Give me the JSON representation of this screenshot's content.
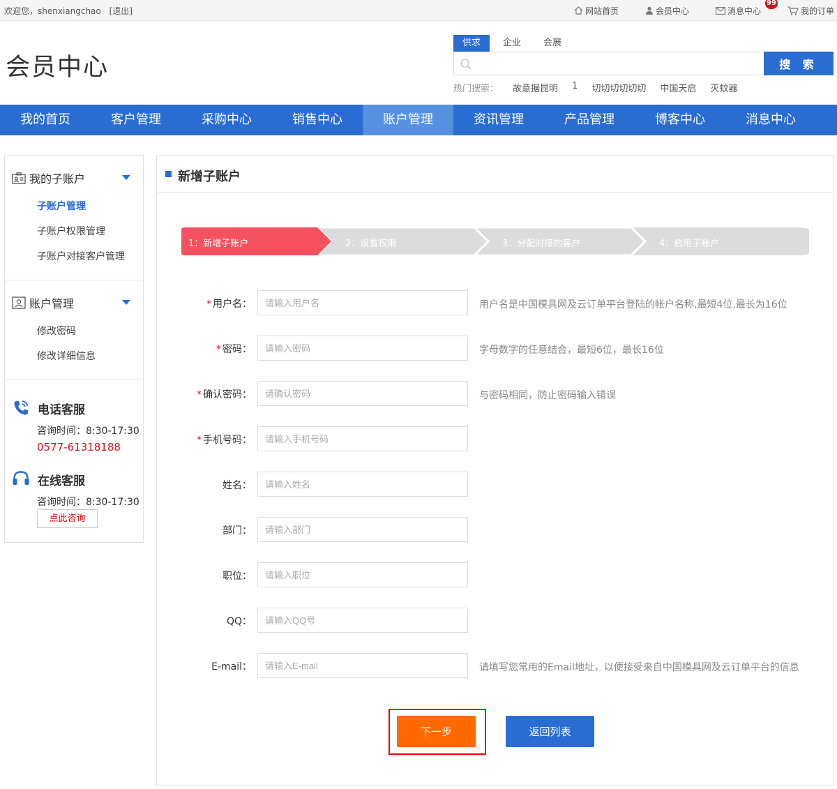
{
  "topbar": {
    "welcome": "欢迎您，shenxiangchao",
    "logout": "[退出]",
    "links": [
      {
        "label": "网站首页",
        "icon": "home-icon"
      },
      {
        "label": "会员中心",
        "icon": "user-icon"
      },
      {
        "label": "消息中心",
        "icon": "mail-icon",
        "badge": "99"
      },
      {
        "label": "我的订单",
        "icon": "cart-icon"
      }
    ]
  },
  "header": {
    "logo": "会员中心",
    "search_tabs": [
      "供求",
      "企业",
      "会展"
    ],
    "search_active_tab": "供求",
    "search_button": "搜 索",
    "hot_label": "热门搜索：",
    "hot_words": [
      "故意据昆明",
      "1",
      "切切切切切切",
      "中国天启",
      "灭蚊器"
    ]
  },
  "nav": {
    "items": [
      "我的首页",
      "客户管理",
      "采购中心",
      "销售中心",
      "账户管理",
      "资讯管理",
      "产品管理",
      "博客中心",
      "消息中心"
    ],
    "active": "账户管理"
  },
  "sidebar": {
    "sections": [
      {
        "title": "我的子账户",
        "icon": "id-card-icon",
        "items": [
          "子账户管理",
          "子账户权限管理",
          "子账户对接客户管理"
        ],
        "active": "子账户管理"
      },
      {
        "title": "账户管理",
        "icon": "account-icon",
        "items": [
          "修改密码",
          "修改详细信息"
        ]
      }
    ],
    "phone_service": {
      "title": "电话客服",
      "time": "咨询时间：8:30-17:30",
      "phone": "0577-61318188",
      "icon": "phone-icon"
    },
    "online_service": {
      "title": "在线客服",
      "time": "咨询时间：8:30-17:30",
      "button": "点此咨询",
      "icon": "headset-icon"
    }
  },
  "panel": {
    "title": "新增子账户",
    "steps": [
      "1：新增子账户",
      "2：设置权限",
      "3：分配对接的客户",
      "4：启用子账户"
    ],
    "active_step": 1,
    "fields": [
      {
        "label": "用户名：",
        "required": true,
        "placeholder": "请输入用户名",
        "hint": "用户名是中国模具网及云订单平台登陆的帐户名称,最短4位,最长为16位"
      },
      {
        "label": "密码：",
        "required": true,
        "placeholder": "请输入密码",
        "hint": "字母数字的任意结合，最短6位，最长16位"
      },
      {
        "label": "确认密码：",
        "required": true,
        "placeholder": "请确认密码",
        "hint": "与密码相同，防止密码输入错误"
      },
      {
        "label": "手机号码：",
        "required": true,
        "placeholder": "请输入手机号码",
        "hint": ""
      },
      {
        "label": "姓名：",
        "required": false,
        "placeholder": "请输入姓名",
        "hint": ""
      },
      {
        "label": "部门：",
        "required": false,
        "placeholder": "请输入部门",
        "hint": ""
      },
      {
        "label": "职位：",
        "required": false,
        "placeholder": "请输入职位",
        "hint": ""
      },
      {
        "label": "QQ：",
        "required": false,
        "placeholder": "请输入QQ号",
        "hint": ""
      },
      {
        "label": "E-mail：",
        "required": false,
        "placeholder": "请输入E-mail",
        "hint": "请填写您常用的Email地址，以便接受来自中国模具网及云订单平台的信息"
      }
    ],
    "next_button": "下一步",
    "back_button": "返回列表"
  },
  "colors": {
    "primary": "#2a6dd2",
    "nav_active": "#5591e0",
    "step_active": "#f5515f",
    "step_inactive": "#dcdcdc",
    "next": "#ff6a00",
    "required": "#d8101a"
  }
}
